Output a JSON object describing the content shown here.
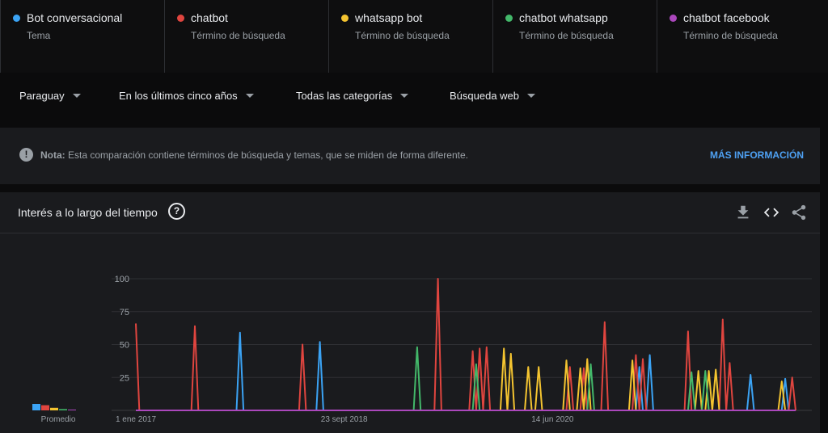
{
  "terms": [
    {
      "name": "Bot conversacional",
      "sub": "Tema",
      "color": "#3ba3f4"
    },
    {
      "name": "chatbot",
      "sub": "Término de búsqueda",
      "color": "#e0453f"
    },
    {
      "name": "whatsapp bot",
      "sub": "Término de búsqueda",
      "color": "#f4c430"
    },
    {
      "name": "chatbot whatsapp",
      "sub": "Término de búsqueda",
      "color": "#43b86a"
    },
    {
      "name": "chatbot facebook",
      "sub": "Término de búsqueda",
      "color": "#ab47bc"
    }
  ],
  "filters": {
    "region": "Paraguay",
    "period": "En los últimos cinco años",
    "category": "Todas las categorías",
    "search_type": "Búsqueda web"
  },
  "note": {
    "label": "Nota:",
    "text": "Esta comparación contiene términos de búsqueda y temas, que se miden de forma diferente.",
    "link": "MÁS INFORMACIÓN"
  },
  "card": {
    "title": "Interés a lo largo del tiempo",
    "icons": [
      "download-icon",
      "embed-icon",
      "share-icon"
    ]
  },
  "chart_data": {
    "type": "line",
    "ylim": [
      0,
      100
    ],
    "yticks": [
      25,
      50,
      75,
      100
    ],
    "xticks": [
      "1 ene 2017",
      "23 sept 2018",
      "14 jun 2020"
    ],
    "avg_label": "Promedio",
    "averages": [
      {
        "series": "Bot conversacional",
        "value": 5
      },
      {
        "series": "chatbot",
        "value": 4
      },
      {
        "series": "whatsapp bot",
        "value": 2
      },
      {
        "series": "chatbot whatsapp",
        "value": 1
      },
      {
        "series": "chatbot facebook",
        "value": 0.5
      }
    ],
    "series": [
      {
        "name": "Bot conversacional",
        "color": "#3ba3f4",
        "spikes": [
          [
            30,
            59
          ],
          [
            53,
            52
          ],
          [
            145,
            33
          ],
          [
            148,
            42
          ],
          [
            177,
            27
          ],
          [
            187,
            24
          ]
        ]
      },
      {
        "name": "chatbot",
        "color": "#e0453f",
        "spikes": [
          [
            0,
            66
          ],
          [
            17,
            64
          ],
          [
            48,
            50
          ],
          [
            87,
            100
          ],
          [
            97,
            45
          ],
          [
            99,
            47
          ],
          [
            101,
            48
          ],
          [
            125,
            33
          ],
          [
            129,
            32
          ],
          [
            135,
            67
          ],
          [
            144,
            42
          ],
          [
            146,
            39
          ],
          [
            159,
            60
          ],
          [
            169,
            69
          ],
          [
            171,
            36
          ],
          [
            189,
            25
          ]
        ]
      },
      {
        "name": "whatsapp bot",
        "color": "#f4c430",
        "spikes": [
          [
            106,
            47
          ],
          [
            108,
            43
          ],
          [
            113,
            33
          ],
          [
            116,
            33
          ],
          [
            124,
            38
          ],
          [
            128,
            32
          ],
          [
            130,
            39
          ],
          [
            143,
            38
          ],
          [
            162,
            30
          ],
          [
            165,
            30
          ],
          [
            167,
            31
          ],
          [
            186,
            22
          ]
        ]
      },
      {
        "name": "chatbot whatsapp",
        "color": "#43b86a",
        "spikes": [
          [
            81,
            48
          ],
          [
            98,
            35
          ],
          [
            131,
            35
          ],
          [
            160,
            29
          ],
          [
            164,
            30
          ]
        ]
      },
      {
        "name": "chatbot facebook",
        "color": "#ab47bc",
        "spikes": []
      }
    ],
    "n_points": 191
  }
}
